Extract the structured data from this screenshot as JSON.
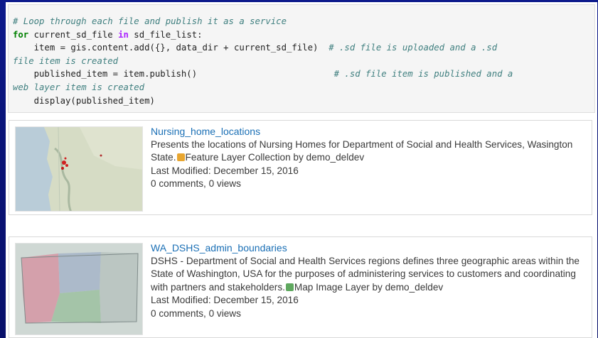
{
  "code": {
    "comment1": "# Loop through each file and publish it as a service",
    "kw_for": "for",
    "for_var": " current_sd_file ",
    "kw_in": "in",
    "for_iter": " sd_file_list:",
    "line3_code": "    item = gis.content.add({}, data_dir + current_sd_file)  ",
    "line3_comment": "# .sd file is uploaded and a .sd",
    "line4_comment": "file item is created",
    "line5_code": "    published_item = item.publish()                          ",
    "line5_comment": "# .sd file item is published and a",
    "line6_comment": "web layer item is created",
    "line7_code": "    display(published_item)"
  },
  "items": [
    {
      "title": "Nursing_home_locations",
      "description": "Presents the locations of Nursing Homes for Department of Social and Health Services, Wasington State.",
      "type_label": "Feature Layer Collection by demo_deldev",
      "modified": "Last Modified: December 15, 2016",
      "stats": "0 comments, 0 views",
      "badge_color": "#e8a630",
      "thumb_icon": "washington-basemap-thumbnail"
    },
    {
      "title": "WA_DSHS_admin_boundaries",
      "description": "DSHS - Department of Social and Health Services regions defines three geographic areas within the State of Washington, USA for the purposes of administering services to customers and coordinating with partners and stakeholders.",
      "type_label": "Map Image Layer by demo_deldev",
      "modified": "Last Modified: December 15, 2016",
      "stats": "0 comments, 0 views",
      "badge_color": "#5fa85f",
      "thumb_icon": "washington-regions-thumbnail"
    }
  ],
  "colors": {
    "background": "#0a1478",
    "link": "#1a6fb5",
    "code_bg": "#f5f5f5"
  }
}
